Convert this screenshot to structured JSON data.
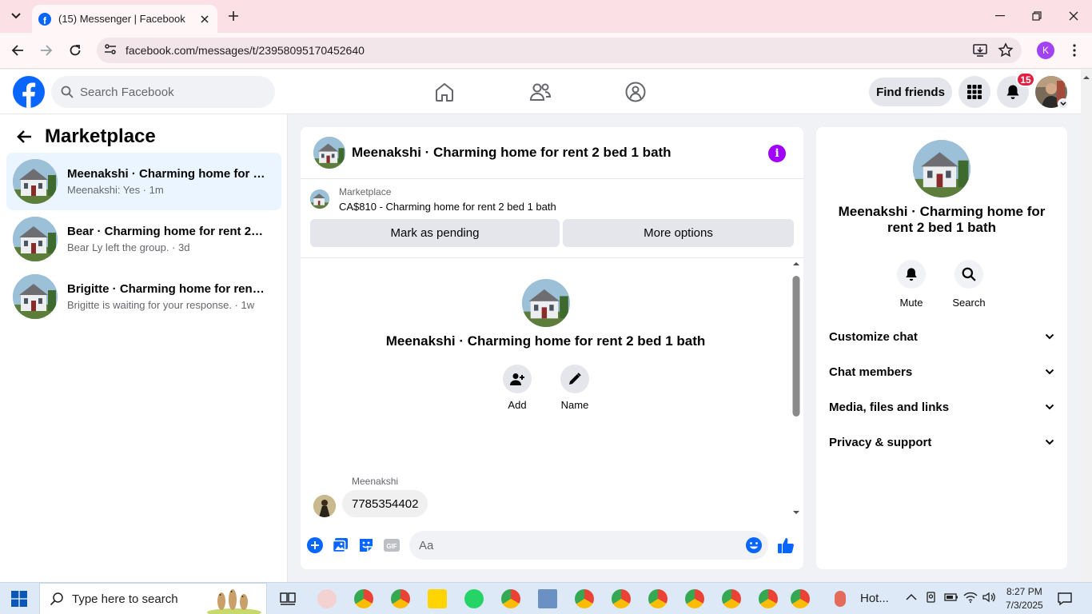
{
  "browser": {
    "tab_title": "(15) Messenger | Facebook",
    "url": "facebook.com/messages/t/23958095170452640",
    "profile_initial": "K"
  },
  "fb_header": {
    "search_placeholder": "Search Facebook",
    "find_friends": "Find friends",
    "notification_count": "15"
  },
  "left_panel": {
    "title": "Marketplace",
    "conversations": [
      {
        "name": "Meenakshi · Charming home for r...",
        "subtitle": "Meenakshi: Yes · 1m",
        "active": true
      },
      {
        "name": "Bear · Charming home for rent 2 b...",
        "subtitle": "Bear Ly left the group. · 3d",
        "active": false
      },
      {
        "name": "Brigitte · Charming home for rent ...",
        "subtitle": "Brigitte is waiting for your response. · 1w",
        "active": false
      }
    ]
  },
  "chat": {
    "title": "Meenakshi · Charming home for rent 2 bed 1 bath",
    "marketplace_label": "Marketplace",
    "listing": "CA$810 - Charming home for rent 2 bed 1 bath",
    "mark_pending": "Mark as pending",
    "more_options": "More options",
    "center_title": "Meenakshi · Charming home for rent 2 bed 1 bath",
    "add_label": "Add",
    "name_label": "Name",
    "sender": "Meenakshi",
    "message": "7785354402",
    "composer_placeholder": "Aa"
  },
  "info_panel": {
    "name": "Meenakshi · Charming home for rent 2 bed 1 bath",
    "mute": "Mute",
    "search": "Search",
    "sections": [
      "Customize chat",
      "Chat members",
      "Media, files and links",
      "Privacy & support"
    ]
  },
  "taskbar": {
    "search_placeholder": "Type here to search",
    "weather": "Hot...",
    "time": "8:27 PM",
    "date": "7/3/2025"
  },
  "colors": {
    "fb_blue": "#0866ff",
    "messenger_purple": "#a100ff",
    "active_conv_bg": "#ebf5ff",
    "tab_strip": "#fbe1e6"
  }
}
